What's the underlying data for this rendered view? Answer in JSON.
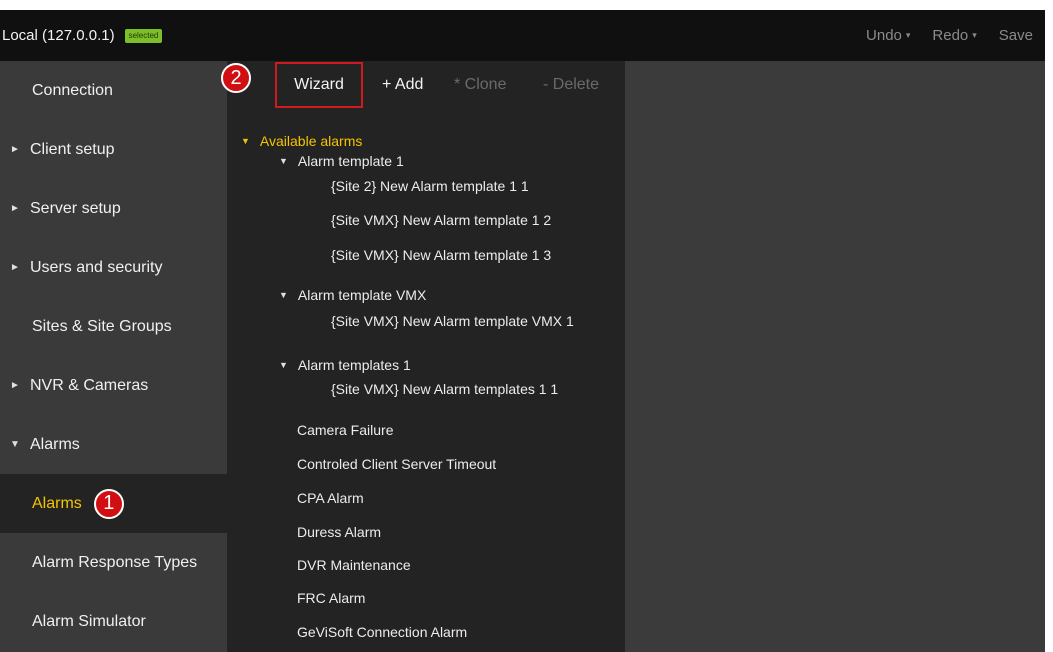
{
  "topbar": {
    "connection": "Local (127.0.0.1)",
    "badge": "selected",
    "undo": "Undo",
    "redo": "Redo",
    "save": "Save",
    "caret": "▾"
  },
  "sidebar": {
    "items": [
      {
        "label": "Connection"
      },
      {
        "label": "Client setup",
        "arrow": "►"
      },
      {
        "label": "Server setup",
        "arrow": "►"
      },
      {
        "label": "Users and security",
        "arrow": "►"
      },
      {
        "label": "Sites & Site Groups"
      },
      {
        "label": "NVR & Cameras",
        "arrow": "►"
      },
      {
        "label": "Alarms",
        "arrow": "▼"
      },
      {
        "label": "Alarms",
        "selected": true
      },
      {
        "label": "Alarm Response Types"
      },
      {
        "label": "Alarm Simulator"
      }
    ]
  },
  "markers": {
    "one": "1",
    "two": "2"
  },
  "toolbar": {
    "wizard": "Wizard",
    "add": "+ Add",
    "clone": "* Clone",
    "delete": "- Delete"
  },
  "tree": {
    "expand_glyph": "▼",
    "root": "Available alarms",
    "groups": [
      {
        "name": "Alarm template 1",
        "children": [
          "{Site 2} New Alarm template 1 1",
          "{Site VMX} New Alarm template 1 2",
          "{Site VMX} New Alarm template 1 3"
        ]
      },
      {
        "name": "Alarm template VMX",
        "children": [
          "{Site VMX} New Alarm template VMX 1"
        ]
      },
      {
        "name": "Alarm templates 1",
        "children": [
          "{Site VMX} New Alarm templates 1 1"
        ]
      }
    ],
    "alarms": [
      "Camera Failure",
      "Controled Client Server Timeout",
      "CPA Alarm",
      "Duress Alarm",
      "DVR Maintenance",
      "FRC Alarm",
      "GeViSoft Connection Alarm"
    ]
  },
  "colors": {
    "accent": "#f5c400",
    "badge": "#7cbf2a",
    "marker": "#d10f12",
    "highlight_border": "#d11a1f"
  }
}
